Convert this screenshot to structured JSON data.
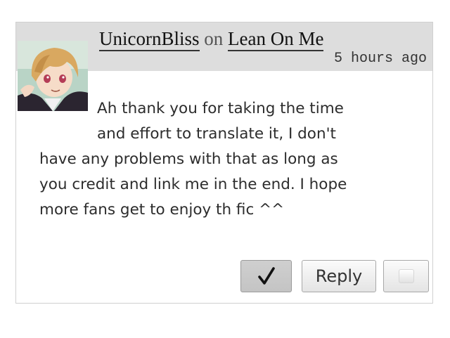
{
  "comment": {
    "author": "UnicornBliss",
    "connector": "on",
    "work_title": "Lean On Me",
    "timestamp": "5 hours ago",
    "body_lines": [
      "Ah thank you for taking the time",
      "and effort to translate it, I don't",
      "have any problems with that as long as",
      "you credit and link me in the end. I hope",
      "more fans get to enjoy th fic ^^"
    ]
  },
  "actions": {
    "check_icon": "checkmark-icon",
    "reply_label": "Reply",
    "more_icon": "square-icon"
  },
  "colors": {
    "header_bg": "#dddddd",
    "border": "#d0d0d0",
    "text": "#2c2c2c"
  }
}
